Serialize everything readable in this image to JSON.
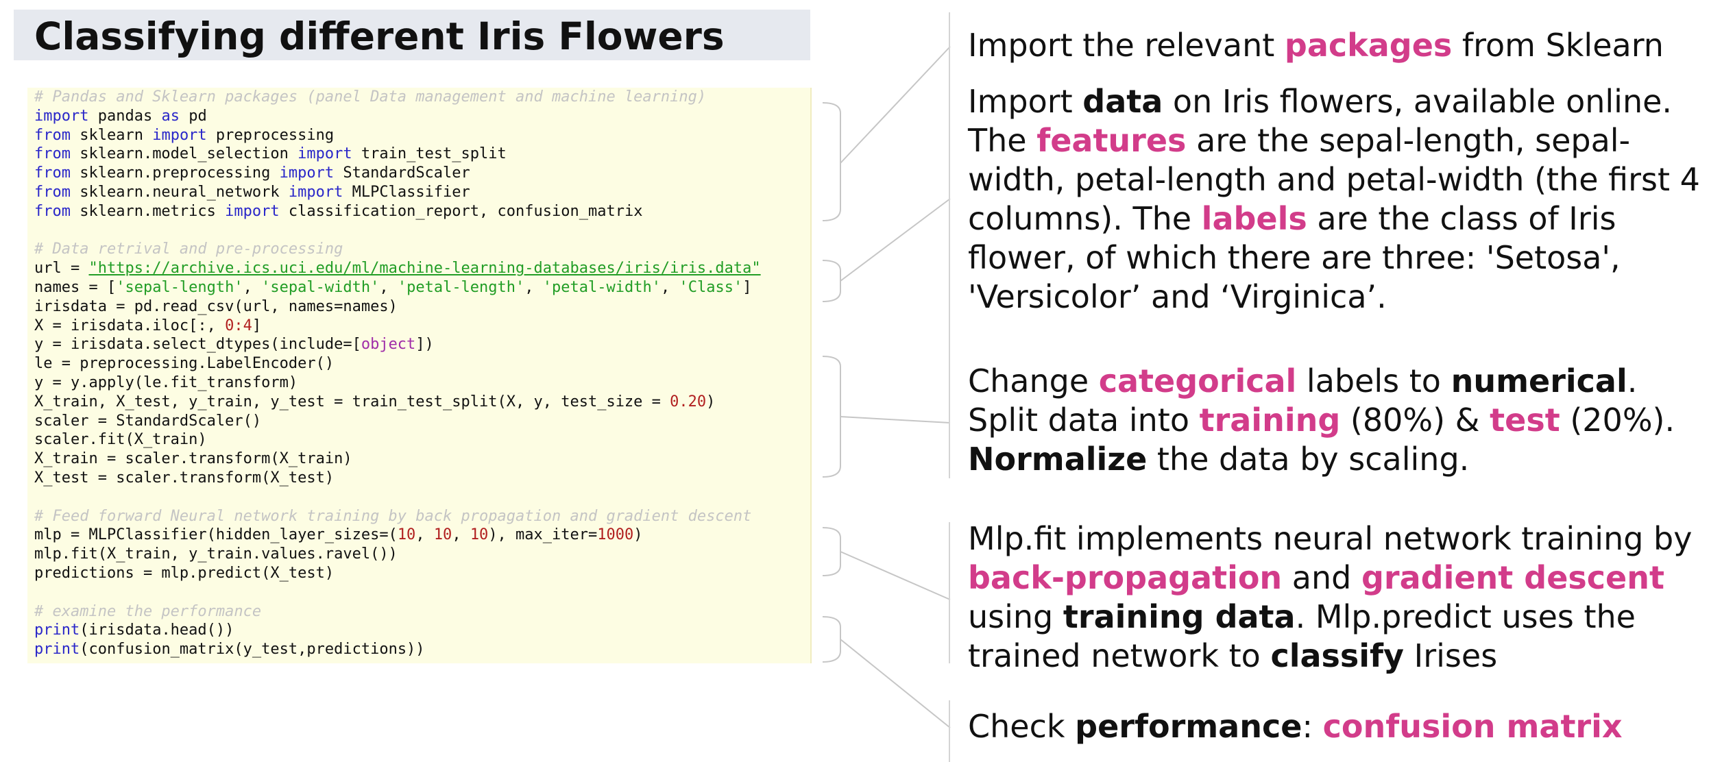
{
  "title": "Classifying different Iris Flowers",
  "code": {
    "c1": "# Pandas and Sklearn packages (panel Data management and machine learning)",
    "import": "import",
    "as": "as",
    "from": "from",
    "pd": "pd",
    "pandas": " pandas ",
    "sklearn": " sklearn ",
    "preprocessing": " preprocessing",
    "model_selection": " sklearn.model_selection ",
    "train_test_split": " train_test_split",
    "sk_preprocessing": " sklearn.preprocessing ",
    "standardscaler": " StandardScaler",
    "neural_network": " sklearn.neural_network ",
    "mlpclassifier": " MLPClassifier",
    "metrics": " sklearn.metrics ",
    "metrics_names": " classification_report, confusion_matrix",
    "c2": "# Data retrival and pre-processing",
    "url_prefix": "url = ",
    "url": "\"https://archive.ics.uci.edu/ml/machine-learning-databases/iris/iris.data\"",
    "names_prefix": "names = [",
    "names_s1": "'sepal-length'",
    "names_s2": "'sepal-width'",
    "names_s3": "'petal-length'",
    "names_s4": "'petal-width'",
    "names_s5": "'Class'",
    "irisdata": "irisdata = pd.read_csv(url, names=names)",
    "x_prefix": "X = irisdata.iloc[:, ",
    "x_range": "0:4",
    "x_suffix": "]",
    "y_prefix": "y = irisdata.select_dtypes(include=[",
    "y_obj": "object",
    "y_suffix": "])",
    "le": "le = preprocessing.LabelEncoder()",
    "yapply": "y = y.apply(le.fit_transform)",
    "split_prefix": "X_train, X_test, y_train, y_test = train_test_split(X, y, test_size = ",
    "split_num": "0.20",
    "split_suffix": ")",
    "scaler": "scaler = StandardScaler()",
    "scalerfit": "scaler.fit(X_train)",
    "xtrain": "X_train = scaler.transform(X_train)",
    "xtest": "X_test = scaler.transform(X_test)",
    "c3": "# Feed forward Neural network training by back propagation and gradient descent",
    "mlp_prefix": "mlp = MLPClassifier(hidden_layer_sizes=(",
    "mlp_n1": "10",
    "mlp_n2": "10",
    "mlp_n3": "10",
    "mlp_mid": "), max_iter=",
    "mlp_iter": "1000",
    "mlp_suffix": ")",
    "mlpfit": "mlp.fit(X_train, y_train.values.ravel())",
    "predictions": "predictions = mlp.predict(X_test)",
    "c4": "# examine the performance",
    "print": "print",
    "print1_rest": "(irisdata.head())",
    "print2_rest": "(confusion_matrix(y_test,predictions))"
  },
  "annotations": {
    "a1": {
      "t1": "Import the relevant ",
      "h1": "packages",
      "t2": " from Sklearn"
    },
    "a2": {
      "t1": "Import ",
      "b1": "data",
      "t2": " on Iris flowers, available online. The ",
      "h1": "features",
      "t3": " are the sepal-length, sepal-width, petal-length and petal-width (the first 4 columns). The ",
      "h2": "labels",
      "t4": " are the class of Iris flower, of which there are three: 'Setosa', 'Versicolor’ and ‘Virginica’."
    },
    "a3": {
      "t1": "Change ",
      "h1": "categorical",
      "t2": " labels to ",
      "b1": "numerical",
      "t3": ". Split data into ",
      "h2": "training",
      "t4": " (80%) & ",
      "h3": "test",
      "t5": " (20%). ",
      "b2": "Normalize",
      "t6": " the data by scaling."
    },
    "a4": {
      "t1": "Mlp.fit implements neural network training by ",
      "h1": "back-propagation",
      "t2": " and ",
      "h2": "gradient descent",
      "t3": " using ",
      "b1": "training data",
      "t4": ". Mlp.predict uses the trained network to ",
      "b2": "classify",
      "t5": " Irises"
    },
    "a5": {
      "t1": "Check ",
      "b1": "performance",
      "t2": ": ",
      "h1": "confusion matrix"
    }
  },
  "colors": {
    "highlight": "#d23c8a",
    "code_background": "#fdfde3",
    "title_background": "#e6e9ef",
    "keyword": "#2a27c9",
    "number": "#b11f1f",
    "string": "#219d25",
    "comment": "#c4c4c4"
  }
}
